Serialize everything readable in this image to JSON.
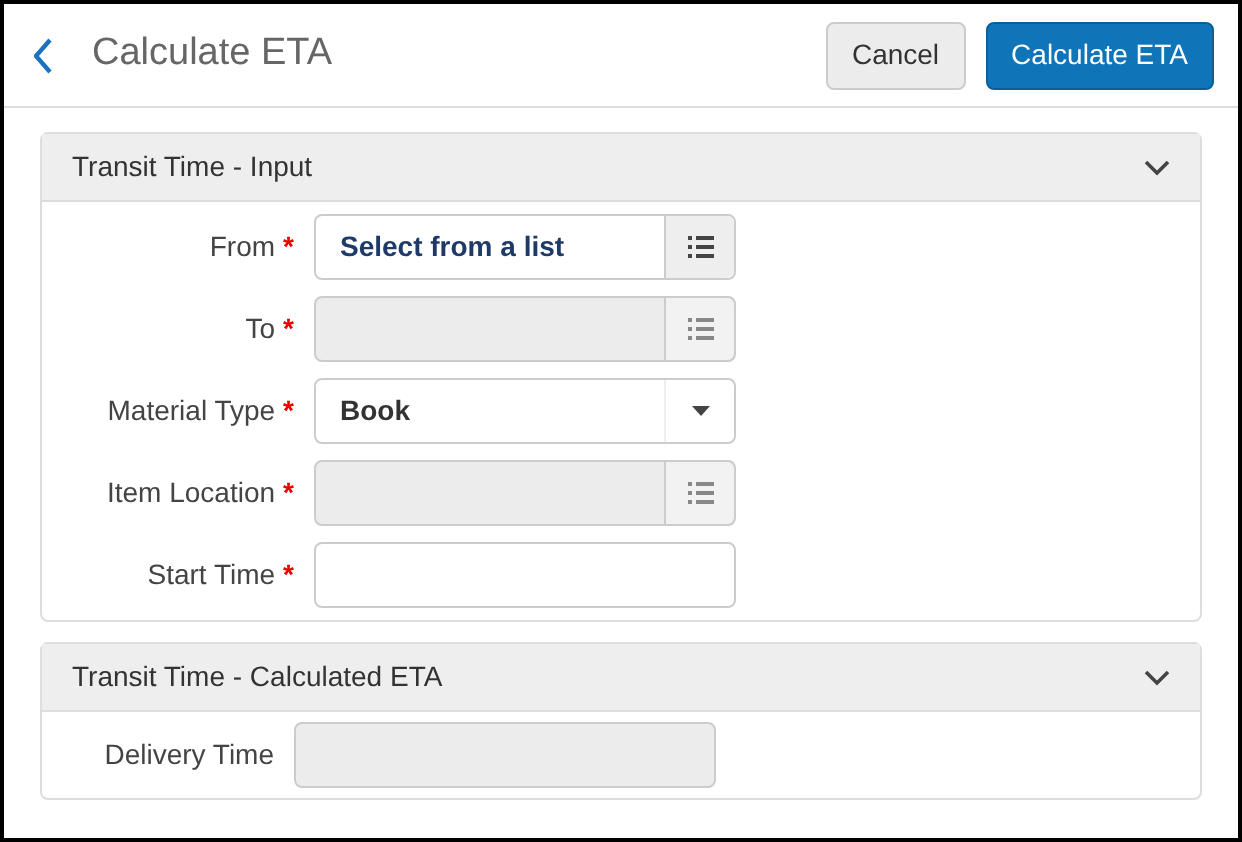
{
  "header": {
    "title": "Calculate ETA",
    "buttons": [
      {
        "label": "Cancel",
        "kind": "secondary"
      },
      {
        "label": "Calculate ETA",
        "kind": "primary"
      }
    ]
  },
  "sections": [
    {
      "title": "Transit Time - Input",
      "expanded": true,
      "fields": [
        {
          "label": "From",
          "required_mark": "*",
          "kind": "list-picker",
          "disabled": false,
          "value": "Select from a list"
        },
        {
          "label": "To",
          "required_mark": "*",
          "kind": "list-picker",
          "disabled": true
        },
        {
          "label": "Material Type",
          "required_mark": "*",
          "kind": "select",
          "disabled": false,
          "value": "Book"
        },
        {
          "label": "Item Location",
          "required_mark": "*",
          "kind": "list-picker",
          "disabled": true
        },
        {
          "label": "Start Time",
          "required_mark": "*",
          "kind": "text",
          "disabled": false
        }
      ]
    },
    {
      "title": "Transit Time - Calculated ETA",
      "expanded": true,
      "fields": [
        {
          "label": "Delivery Time",
          "kind": "text",
          "disabled": true
        }
      ]
    }
  ]
}
